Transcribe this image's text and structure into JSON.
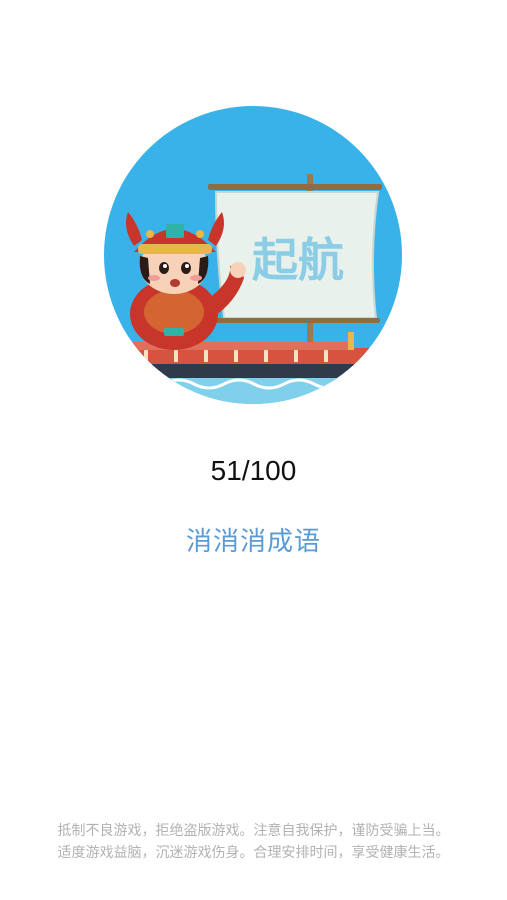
{
  "splash": {
    "logo": {
      "sail_text": "起航",
      "icon": "mascot-ship-logo-icon"
    },
    "progress_text": "51/100",
    "game_title": "消消消成语",
    "game_title_color": "#5b9bd5",
    "anti_addiction_notice": {
      "line1": "抵制不良游戏，拒绝盗版游戏。注意自我保护，谨防受骗上当。",
      "line2": "适度游戏益脑，沉迷游戏伤身。合理安排时间，享受健康生活。"
    }
  },
  "colors": {
    "logo_background": "#39b2ea",
    "sail": "#e8f1ec",
    "sail_text": "#8ccde6",
    "mascot_red": "#c8352b",
    "mascot_gold": "#e8b74a",
    "sea": "#7fd0ea",
    "notice": "#b2b2b2"
  }
}
